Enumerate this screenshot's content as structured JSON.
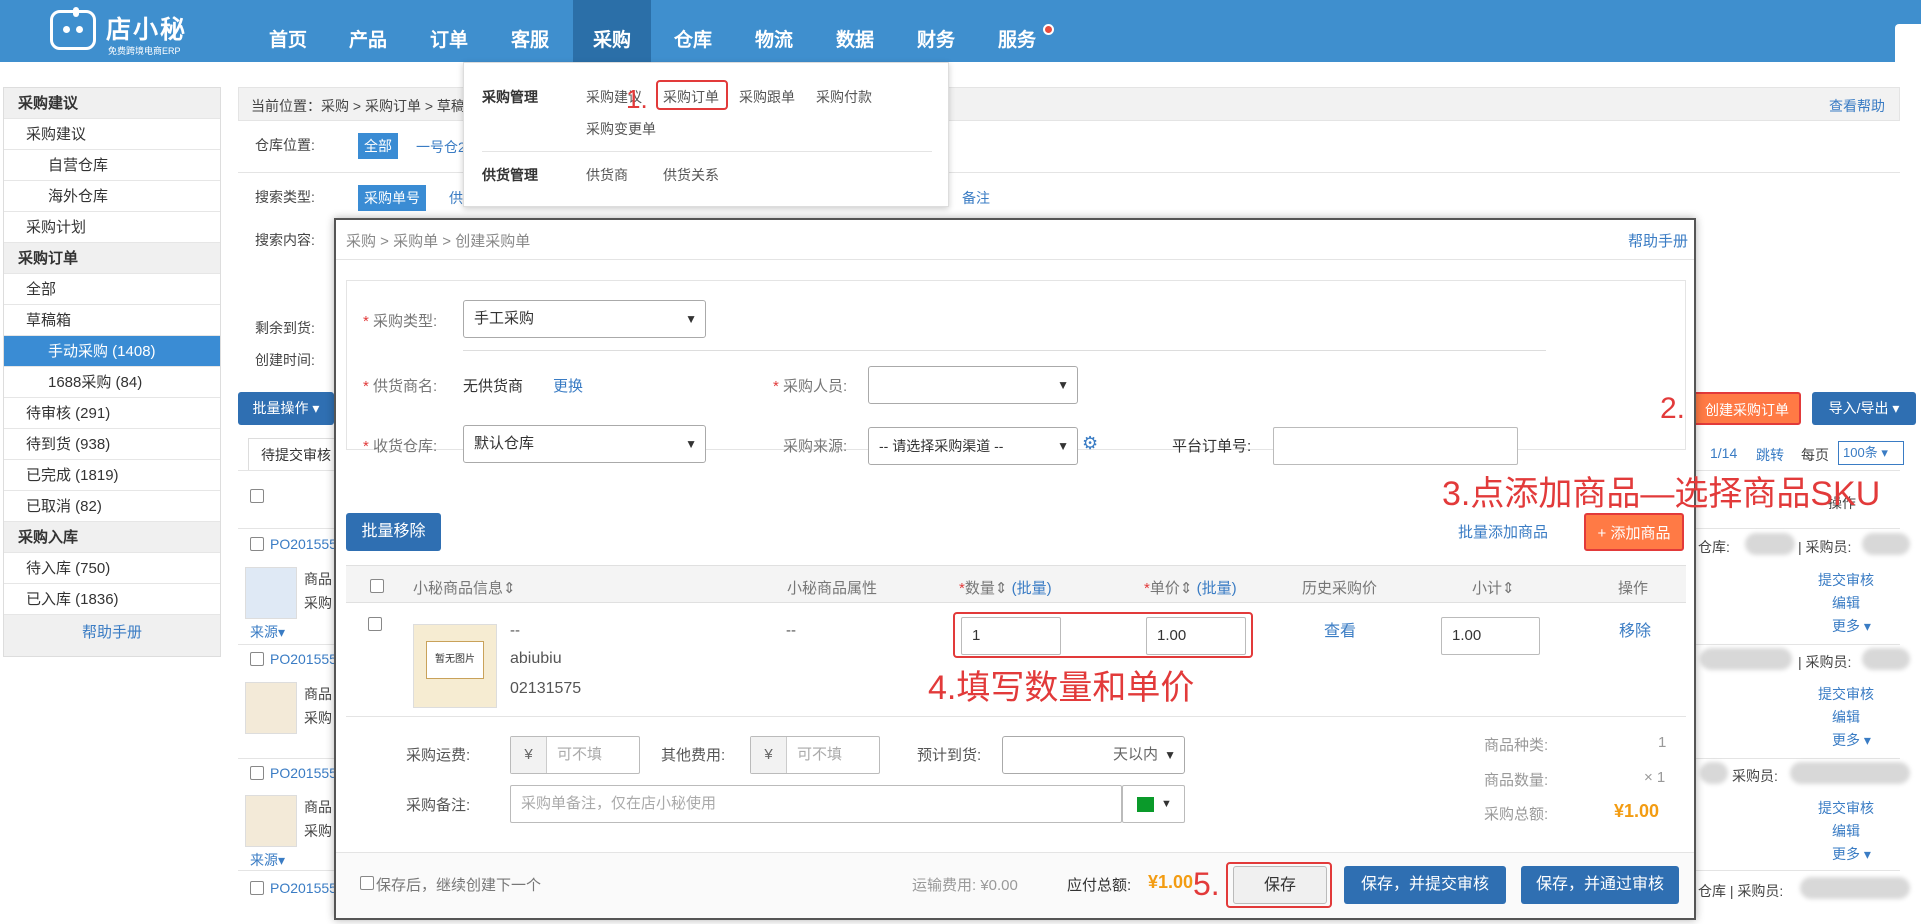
{
  "header": {
    "logo_title": "店小秘",
    "logo_subtitle": "免费跨境电商ERP",
    "nav": [
      "首页",
      "产品",
      "订单",
      "客服",
      "采购",
      "仓库",
      "物流",
      "数据",
      "财务",
      "服务"
    ],
    "active_nav": "采购"
  },
  "dropdown": {
    "group1_title": "采购管理",
    "group1_items": [
      "采购建议",
      "采购订单",
      "采购跟单",
      "采购付款",
      "采购变更单"
    ],
    "group2_title": "供货管理",
    "group2_items": [
      "供货商",
      "供货关系"
    ]
  },
  "sidebar": {
    "items": [
      {
        "label": "采购建议",
        "kind": "head"
      },
      {
        "label": "采购建议",
        "kind": "l1"
      },
      {
        "label": "自营仓库",
        "kind": "l2"
      },
      {
        "label": "海外仓库",
        "kind": "l2"
      },
      {
        "label": "采购计划",
        "kind": "l1"
      },
      {
        "label": "采购订单",
        "kind": "head"
      },
      {
        "label": "全部",
        "kind": "l1"
      },
      {
        "label": "草稿箱",
        "kind": "l1"
      },
      {
        "label": "手动采购 (1408)",
        "kind": "l2 sel"
      },
      {
        "label": "1688采购 (84)",
        "kind": "l2"
      },
      {
        "label": "待审核 (291)",
        "kind": "l1"
      },
      {
        "label": "待到货 (938)",
        "kind": "l1"
      },
      {
        "label": "已完成 (1819)",
        "kind": "l1"
      },
      {
        "label": "已取消 (82)",
        "kind": "l1"
      },
      {
        "label": "采购入库",
        "kind": "head"
      },
      {
        "label": "待入库 (750)",
        "kind": "l1"
      },
      {
        "label": "已入库 (1836)",
        "kind": "l1"
      }
    ],
    "help": "帮助手册"
  },
  "page": {
    "breadcrumb": "当前位置：采购 > 采购订单 > 草稿箱",
    "help_link": "查看帮助",
    "warehouse_label": "仓库位置:",
    "warehouse_all": "全部",
    "warehouse_one": "一号仓2",
    "search_type_label": "搜索类型:",
    "search_type_selected": "采购单号",
    "search_type_more": "供",
    "search_type_note": "备注",
    "search_content_label": "搜索内容:",
    "remaining_label": "剩余到货:",
    "created_label": "创建时间:",
    "batch_ops": "批量操作",
    "create_po": "创建采购订单",
    "import_export": "导入/导出",
    "tab_pending": "待提交审核",
    "pager": "1/14",
    "jump": "跳转",
    "per_page_label": "每页",
    "per_page": "100条",
    "col_ops": "操作",
    "orders": [
      "PO201555",
      "PO201555",
      "PO201555",
      "PO201555"
    ],
    "row_text_product": "商品",
    "row_text_buy": "采购",
    "row_source": "来源",
    "row_warehouse": "仓库:",
    "row_buyer": "| 采购员:",
    "row_buyer2": "采购员:",
    "row_wh_buyer": "仓库 | 采购员:",
    "row_actions": [
      "提交审核",
      "编辑",
      "更多"
    ]
  },
  "modal": {
    "breadcrumb": "采购 > 采购单 > 创建采购单",
    "help": "帮助手册",
    "type_label": "采购类型:",
    "type_value": "手工采购",
    "supplier_label": "供货商名:",
    "supplier_value": "无供货商",
    "supplier_change": "更换",
    "buyer_label": "采购人员:",
    "buyer_value": "",
    "warehouse_label": "收货仓库:",
    "warehouse_value": "默认仓库",
    "source_label": "采购来源:",
    "source_value": "-- 请选择采购渠道 --",
    "platform_label": "平台订单号:",
    "platform_value": "",
    "batch_remove": "批量移除",
    "batch_add": "批量添加商品",
    "add_product": "+ 添加商品",
    "table_headers": {
      "info": "小秘商品信息",
      "attr": "小秘商品属性",
      "qty": "数量",
      "price": "单价",
      "batch": "(批量)",
      "history": "历史采购价",
      "subtotal": "小计",
      "ops": "操作"
    },
    "row": {
      "dash": "--",
      "attr": "--",
      "name": "abiubiu",
      "code": "02131575",
      "no_image": "暂无图片",
      "qty": "1",
      "price": "1.00",
      "history": "查看",
      "subtotal": "1.00",
      "remove": "移除"
    },
    "freight_label": "采购运费:",
    "other_label": "其他费用:",
    "currency": "¥",
    "optional_placeholder": "可不填",
    "eta_label": "预计到货:",
    "eta_unit": "天以内",
    "remark_label": "采购备注:",
    "remark_placeholder": "采购单备注，仅在店小秘使用",
    "summary": {
      "kinds_label": "商品种类:",
      "kinds_value": "1",
      "count_label": "商品数量:",
      "count_value": "× 1",
      "total_label": "采购总额:",
      "total_value": "¥1.00"
    },
    "footer": {
      "continue_label": "保存后，继续创建下一个",
      "shipping": "运输费用: ¥0.00",
      "payable_label": "应付总额:",
      "payable_value": "¥1.00",
      "save": "保存",
      "save_submit": "保存，并提交审核",
      "save_approve": "保存，并通过审核"
    }
  },
  "annotations": {
    "step1": "1.",
    "step2": "2.",
    "step3": "3.点添加商品—选择商品SKU",
    "step4": "4.填写数量和单价",
    "step5": "5."
  },
  "colors": {
    "brand": "#3f8fce",
    "accent": "#ff7a45",
    "annotation": "#e23a3a",
    "link": "#3a7cc4"
  }
}
